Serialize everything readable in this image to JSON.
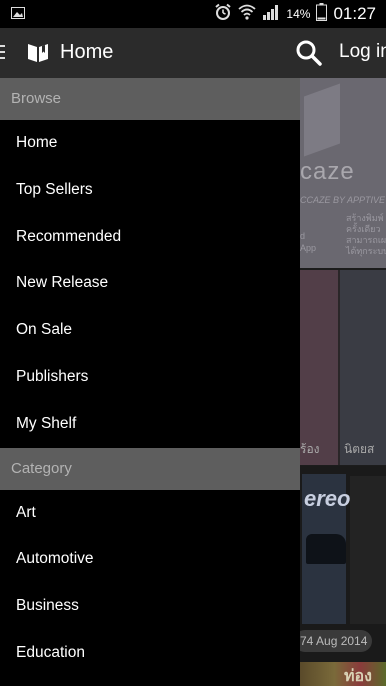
{
  "status_bar": {
    "time": "01:27",
    "battery_percent": "14%",
    "icons": [
      "image-icon",
      "alarm-icon",
      "wifi-icon",
      "signal-icon",
      "battery-icon"
    ]
  },
  "action_bar": {
    "title": "Home",
    "login_label": "Log in",
    "icons": [
      "hamburger-icon",
      "book-logo-icon",
      "search-icon"
    ]
  },
  "drawer": {
    "sections": [
      {
        "header": "Browse",
        "items": [
          "Home",
          "Top Sellers",
          "Recommended",
          "New Release",
          "On Sale",
          "Publishers",
          "My Shelf"
        ]
      },
      {
        "header": "Category",
        "items": [
          "Art",
          "Automotive",
          "Business",
          "Education"
        ]
      }
    ]
  },
  "background": {
    "banner_brand": "caze",
    "banner_tagline": "CCAZE BY APPTIVE",
    "banner_app_text": [
      "d",
      "App"
    ],
    "banner_thai_text": [
      "สร้างพิมพ์",
      "ครั้งเดียว",
      "สามารถเผ",
      "ได้ทุกระบบ"
    ],
    "row_captions": [
      "ร้อง",
      "นิตยส"
    ],
    "magazine_title": "ereo",
    "date_chip": "74 Aug 2014",
    "bottom_text": "ท่อง"
  }
}
